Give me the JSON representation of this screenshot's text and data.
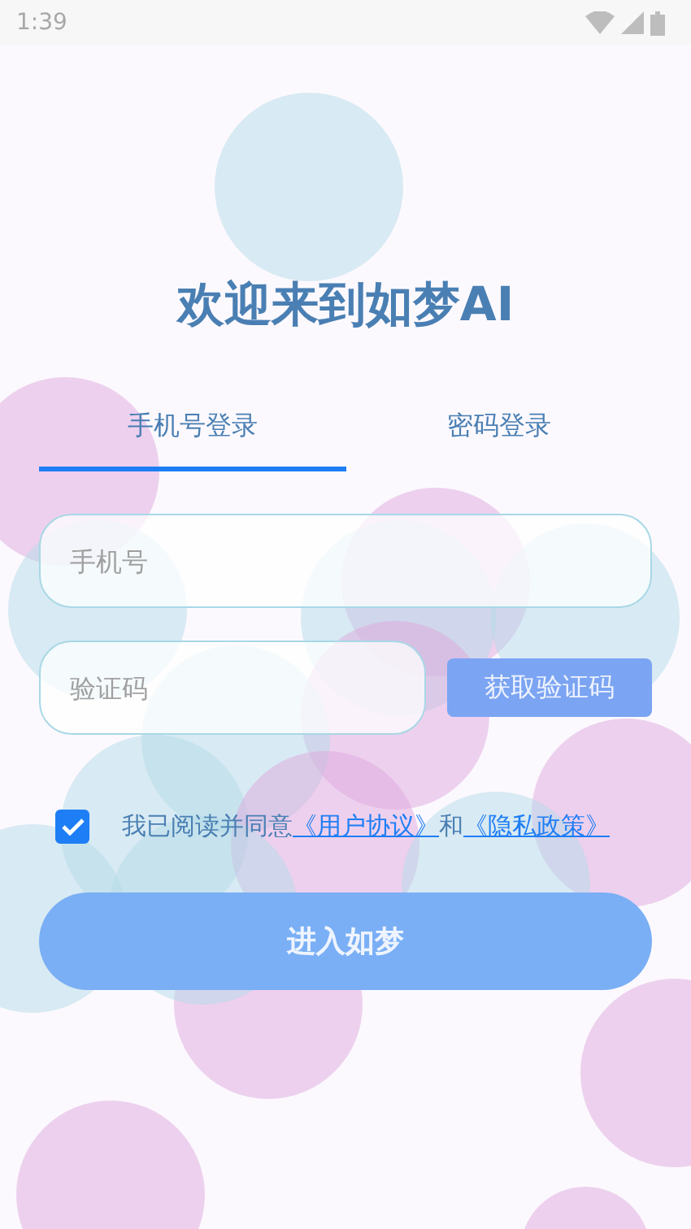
{
  "status_bar": {
    "time": "1:39"
  },
  "title": "欢迎来到如梦AI",
  "tabs": [
    {
      "label": "手机号登录",
      "selected": true
    },
    {
      "label": "密码登录",
      "selected": false
    }
  ],
  "phone_field": {
    "placeholder": "手机号"
  },
  "code_field": {
    "placeholder": "验证码"
  },
  "get_code_button": {
    "label": "获取验证码",
    "disabled": true
  },
  "agreement": {
    "checked": true,
    "text": "我已阅读并同意",
    "link_1": "《用户协议》",
    "joiner": "和",
    "link_2": "《隐私政策》"
  },
  "submit_button": {
    "label": "进入如梦",
    "disabled": true
  }
}
